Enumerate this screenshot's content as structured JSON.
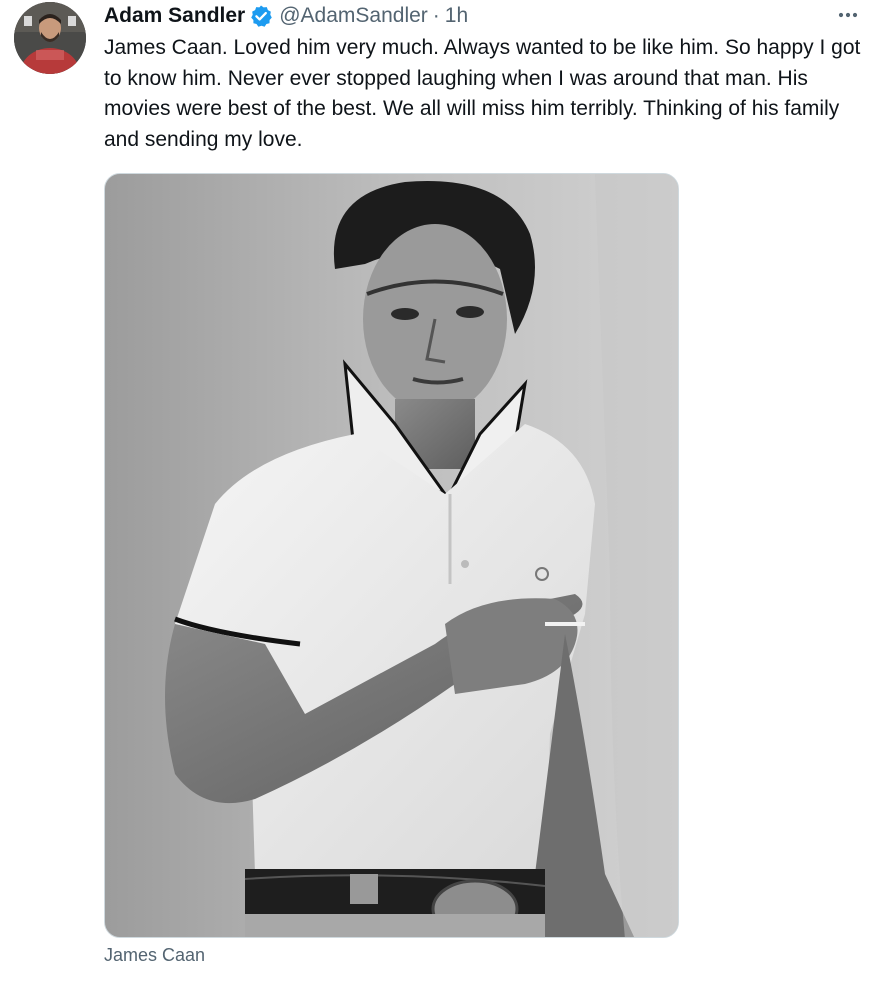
{
  "tweet": {
    "author": {
      "display_name": "Adam Sandler",
      "handle": "@AdamSandler",
      "verified": true,
      "avatar_icon": "profile-photo"
    },
    "separator": "·",
    "timestamp": "1h",
    "more_icon": "ellipsis-icon",
    "text": "James Caan. Loved him very much. Always wanted to be like him. So happy I got to know him. Never ever stopped laughing when I was around that man. His movies were best of the best. We all will miss him terribly. Thinking of his family and sending my love.",
    "media": {
      "type": "photo",
      "style": "black-and-white"
    },
    "media_caption": "James Caan"
  },
  "colors": {
    "text_primary": "#0f1419",
    "text_secondary": "#536471",
    "verified_blue": "#1d9bf0",
    "border": "#cfd9de"
  }
}
